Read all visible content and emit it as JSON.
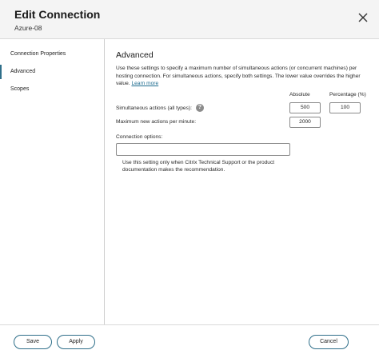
{
  "header": {
    "title": "Edit Connection",
    "subtitle": "Azure-08",
    "close_icon": "close-icon"
  },
  "sidebar": {
    "items": [
      {
        "label": "Connection Properties",
        "active": false
      },
      {
        "label": "Advanced",
        "active": true
      },
      {
        "label": "Scopes",
        "active": false
      }
    ]
  },
  "advanced": {
    "title": "Advanced",
    "description": "Use these settings to specify a maximum number of simultaneous actions (or concurrent machines) per hosting connection. For simultaneous actions, specify both settings. The lower value overrides the higher value.",
    "learn_more": "Learn more",
    "col_absolute": "Absolute",
    "col_percentage": "Percentage (%)",
    "simultaneous_label": "Simultaneous actions (all types):",
    "simultaneous_absolute": "500",
    "simultaneous_percentage": "100",
    "max_new_label": "Maximum new actions per minute:",
    "max_new_value": "2000",
    "connection_options_label": "Connection options:",
    "connection_options_value": "",
    "connection_options_note": "Use this setting only when Citrix Technical Support or the product documentation makes the recommendation."
  },
  "footer": {
    "save_label": "Save",
    "apply_label": "Apply",
    "cancel_label": "Cancel"
  },
  "colors": {
    "accent": "#2f6f8a",
    "link": "#1d6b8f",
    "header_bg": "#f4f4f4"
  }
}
